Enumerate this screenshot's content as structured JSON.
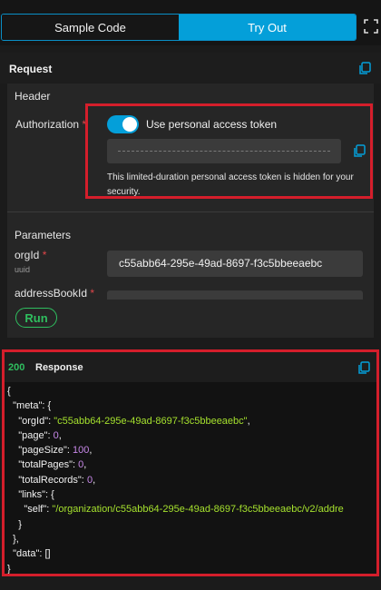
{
  "tabs": [
    {
      "label": "Sample Code",
      "active": false
    },
    {
      "label": "Try Out",
      "active": true
    }
  ],
  "request": {
    "title": "Request",
    "header_label": "Header",
    "authorization_label": "Authorization",
    "required_mark": "*",
    "toggle_on": true,
    "toggle_label": "Use personal access token",
    "token_note": "This limited-duration personal access token is hidden for your security.",
    "parameters_label": "Parameters",
    "params": [
      {
        "name": "orgId",
        "type": "uuid",
        "value": "c55abb64-295e-49ad-8697-f3c5bbeeaebc"
      },
      {
        "name": "addressBookId",
        "type": "",
        "value": ""
      }
    ],
    "run_label": "Run"
  },
  "response": {
    "status": "200",
    "title": "Response",
    "json": {
      "meta": {
        "orgId": "c55abb64-295e-49ad-8697-f3c5bbeeaebc",
        "page": 0,
        "pageSize": 100,
        "totalPages": 0,
        "totalRecords": 0,
        "links": {
          "self": "/organization/c55abb64-295e-49ad-8697-f3c5bbeeaebc/v2/addre"
        }
      },
      "data": "[]"
    }
  },
  "colors": {
    "accent": "#049fd9",
    "success": "#2fbf5f",
    "highlight": "#d41e2b",
    "required": "#e0464a"
  },
  "icons": [
    "expand-icon",
    "copy-icon"
  ]
}
